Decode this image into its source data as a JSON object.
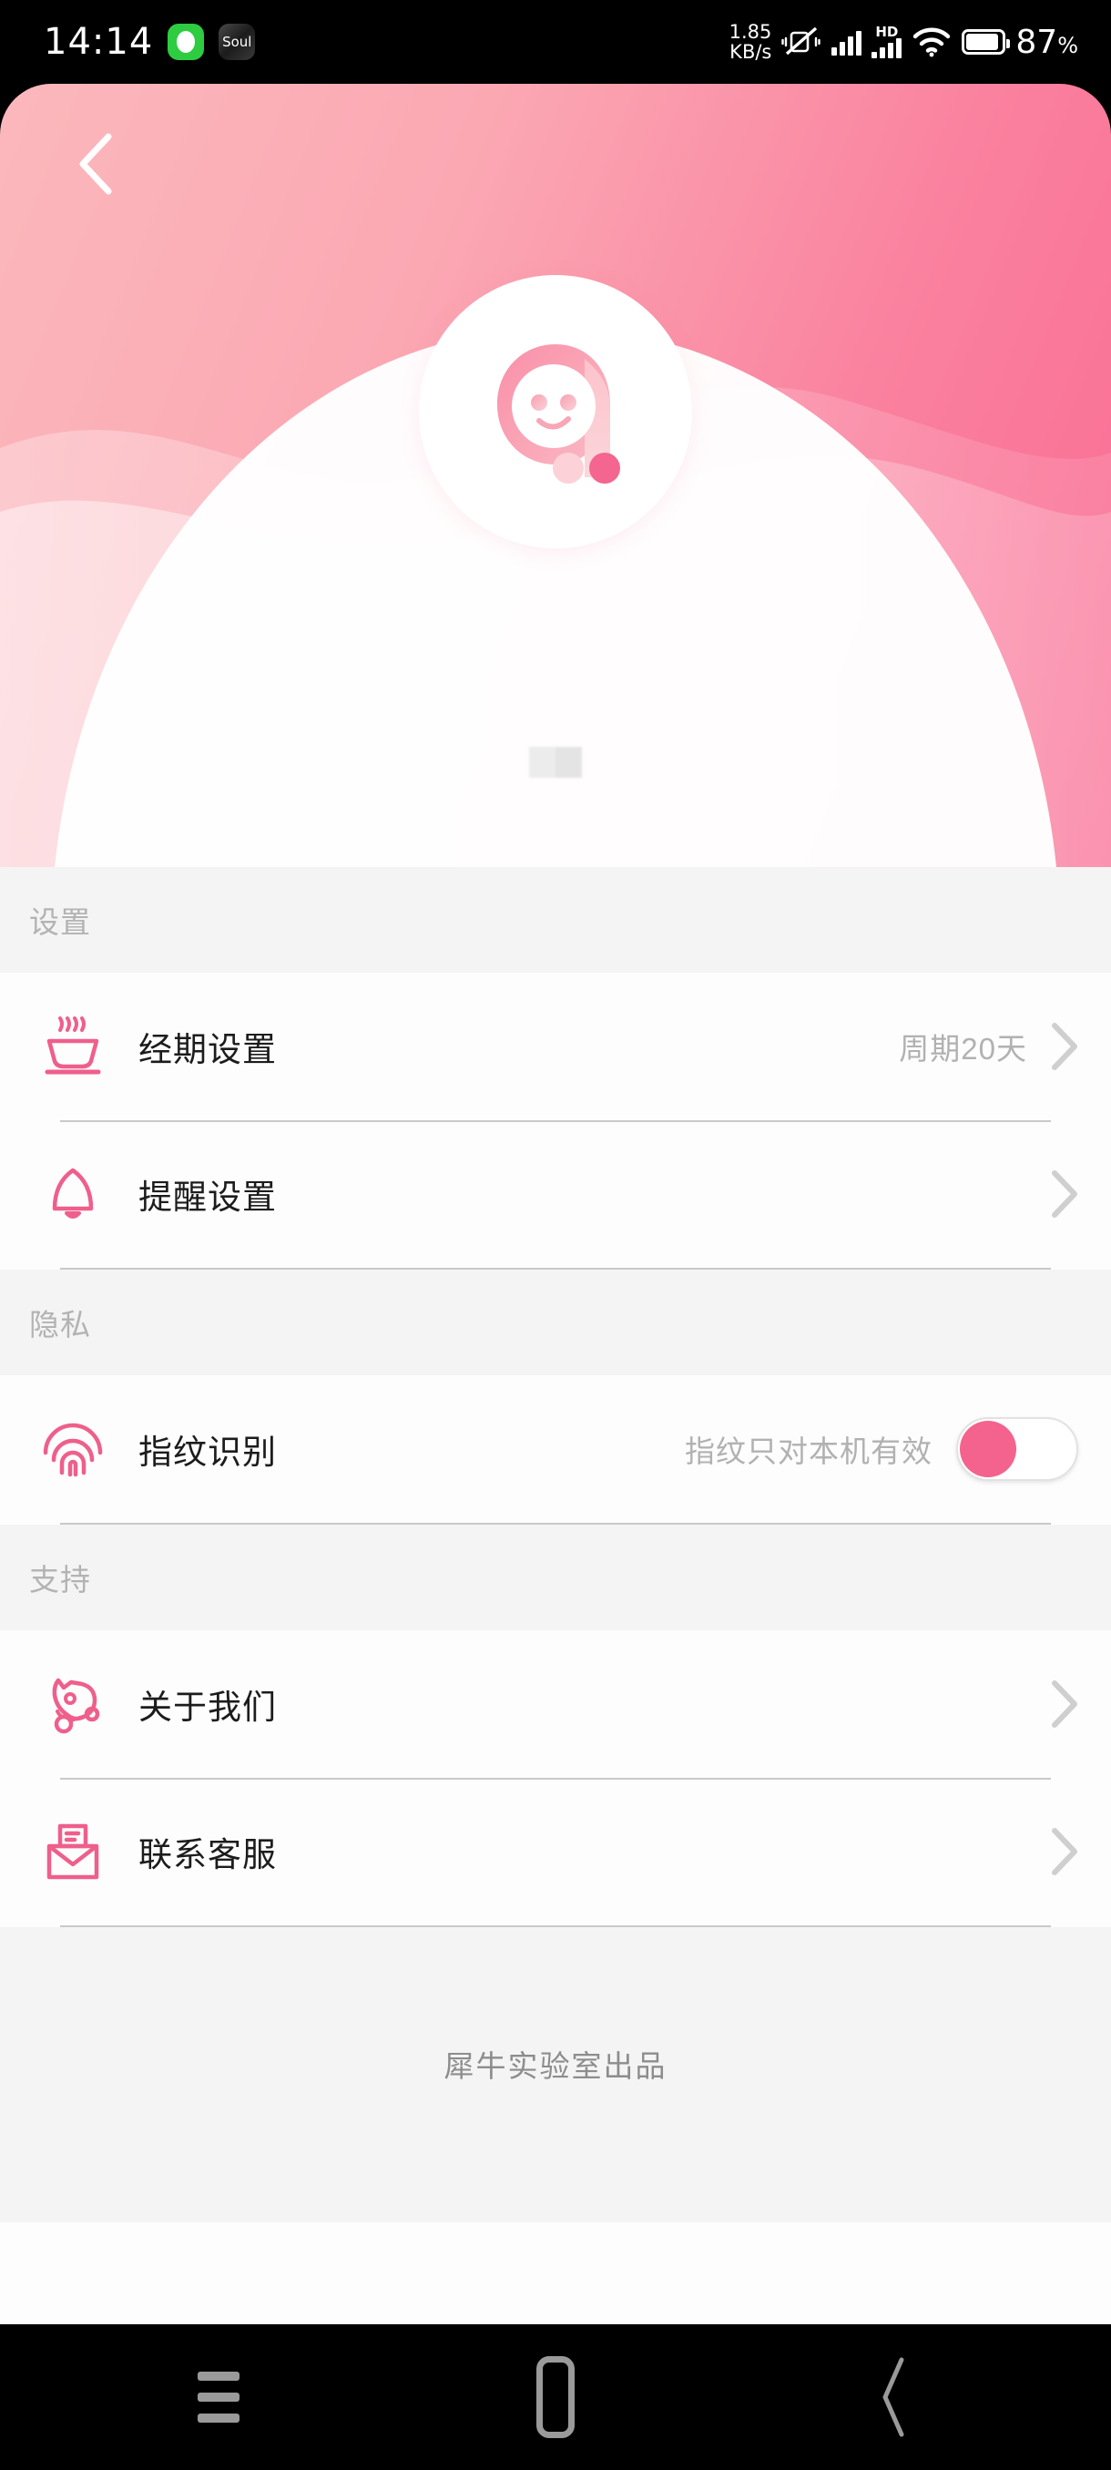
{
  "statusbar": {
    "time": "14:14",
    "app_badge_1": "whatsapp-icon",
    "app_badge_2_label": "Soul",
    "network_speed_value": "1.85",
    "network_speed_unit": "KB/s",
    "mute_icon": "vibrate-off-icon",
    "signal_1": "signal-bars-icon",
    "hd_label": "HD",
    "signal_2": "signal-bars-icon",
    "wifi_icon": "wifi-icon",
    "battery_icon": "battery-icon",
    "battery_percent": "87",
    "battery_unit": "%"
  },
  "header": {
    "back_icon": "chevron-left-icon",
    "avatar_icon": "app-mascot-logo",
    "username_redacted": "",
    "colors": {
      "gradient_from": "#fbb8bc",
      "gradient_to": "#f96c93",
      "accent": "#f4638d"
    }
  },
  "sections": [
    {
      "title": "设置",
      "rows": [
        {
          "icon": "steaming-bowl-icon",
          "label": "经期设置",
          "value": "周期20天",
          "chevron": "chevron-right-icon",
          "control": "chevron"
        },
        {
          "icon": "bell-icon",
          "label": "提醒设置",
          "value": "",
          "chevron": "chevron-right-icon",
          "control": "chevron"
        }
      ]
    },
    {
      "title": "隐私",
      "rows": [
        {
          "icon": "fingerprint-icon",
          "label": "指纹识别",
          "value": "指纹只对本机有效",
          "chevron": "",
          "control": "toggle",
          "toggle_on": false
        }
      ]
    },
    {
      "title": "支持",
      "rows": [
        {
          "icon": "rhino-icon",
          "label": "关于我们",
          "value": "",
          "chevron": "chevron-right-icon",
          "control": "chevron"
        },
        {
          "icon": "envelope-icon",
          "label": "联系客服",
          "value": "",
          "chevron": "chevron-right-icon",
          "control": "chevron"
        }
      ]
    }
  ],
  "footer": {
    "credit": "犀牛实验室出品"
  },
  "navbar": {
    "recents_label": "recents-icon",
    "home_label": "home-icon",
    "back_label": "back-icon"
  }
}
